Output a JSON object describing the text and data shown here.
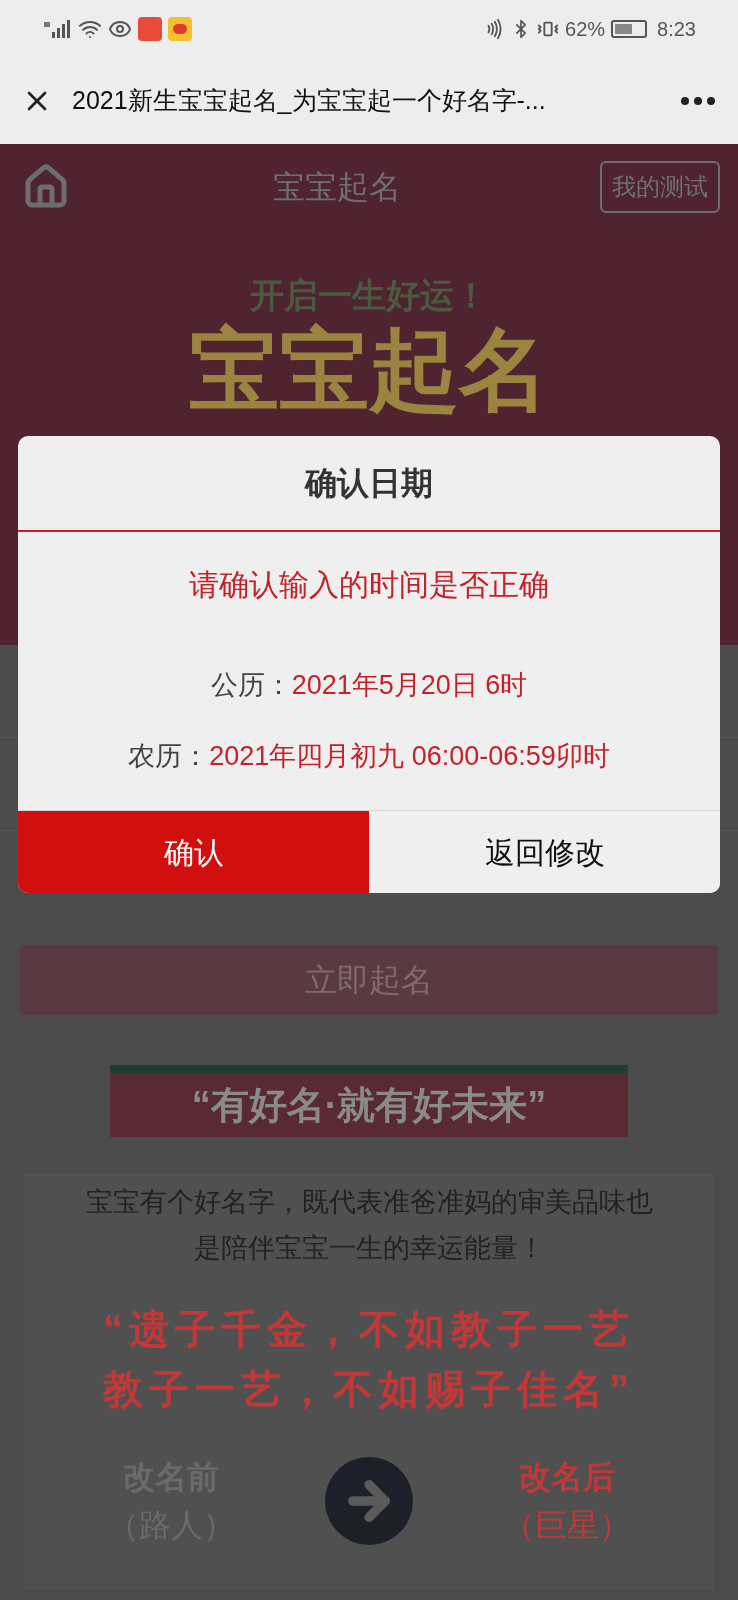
{
  "status_bar": {
    "battery": "62%",
    "time": "8:23"
  },
  "browser": {
    "title": "2021新生宝宝起名_为宝宝起一个好名字-..."
  },
  "header": {
    "title": "宝宝起名",
    "action": "我的测试"
  },
  "banner": {
    "tagline": "开启一生好运！",
    "title": "宝宝起名"
  },
  "form": {
    "submit": "立即起名"
  },
  "intro": {
    "slogan": "“有好名·就有好未来”",
    "text": "宝宝有个好名字，既代表准爸准妈的审美品味也是陪伴宝宝一生的幸运能量！",
    "quote_lines": [
      "“遗子千金，不如教子一艺",
      "教子一艺，不如赐子佳名”"
    ]
  },
  "comparison": [
    {
      "label": "改名前",
      "note": "（路人）",
      "kind": "before"
    },
    {
      "label": "改名后",
      "note": "（巨星）",
      "kind": "after"
    }
  ],
  "dialog": {
    "title": "确认日期",
    "message": "请确认输入的时间是否正确",
    "rows": [
      {
        "label": "公历：",
        "value": "2021年5月20日 6时"
      },
      {
        "label": "农历：",
        "value": "2021年四月初九 06:00-06:59卯时"
      }
    ],
    "buttons": [
      {
        "label": "确认",
        "kind": "primary"
      },
      {
        "label": "返回修改",
        "kind": "secondary"
      }
    ]
  }
}
